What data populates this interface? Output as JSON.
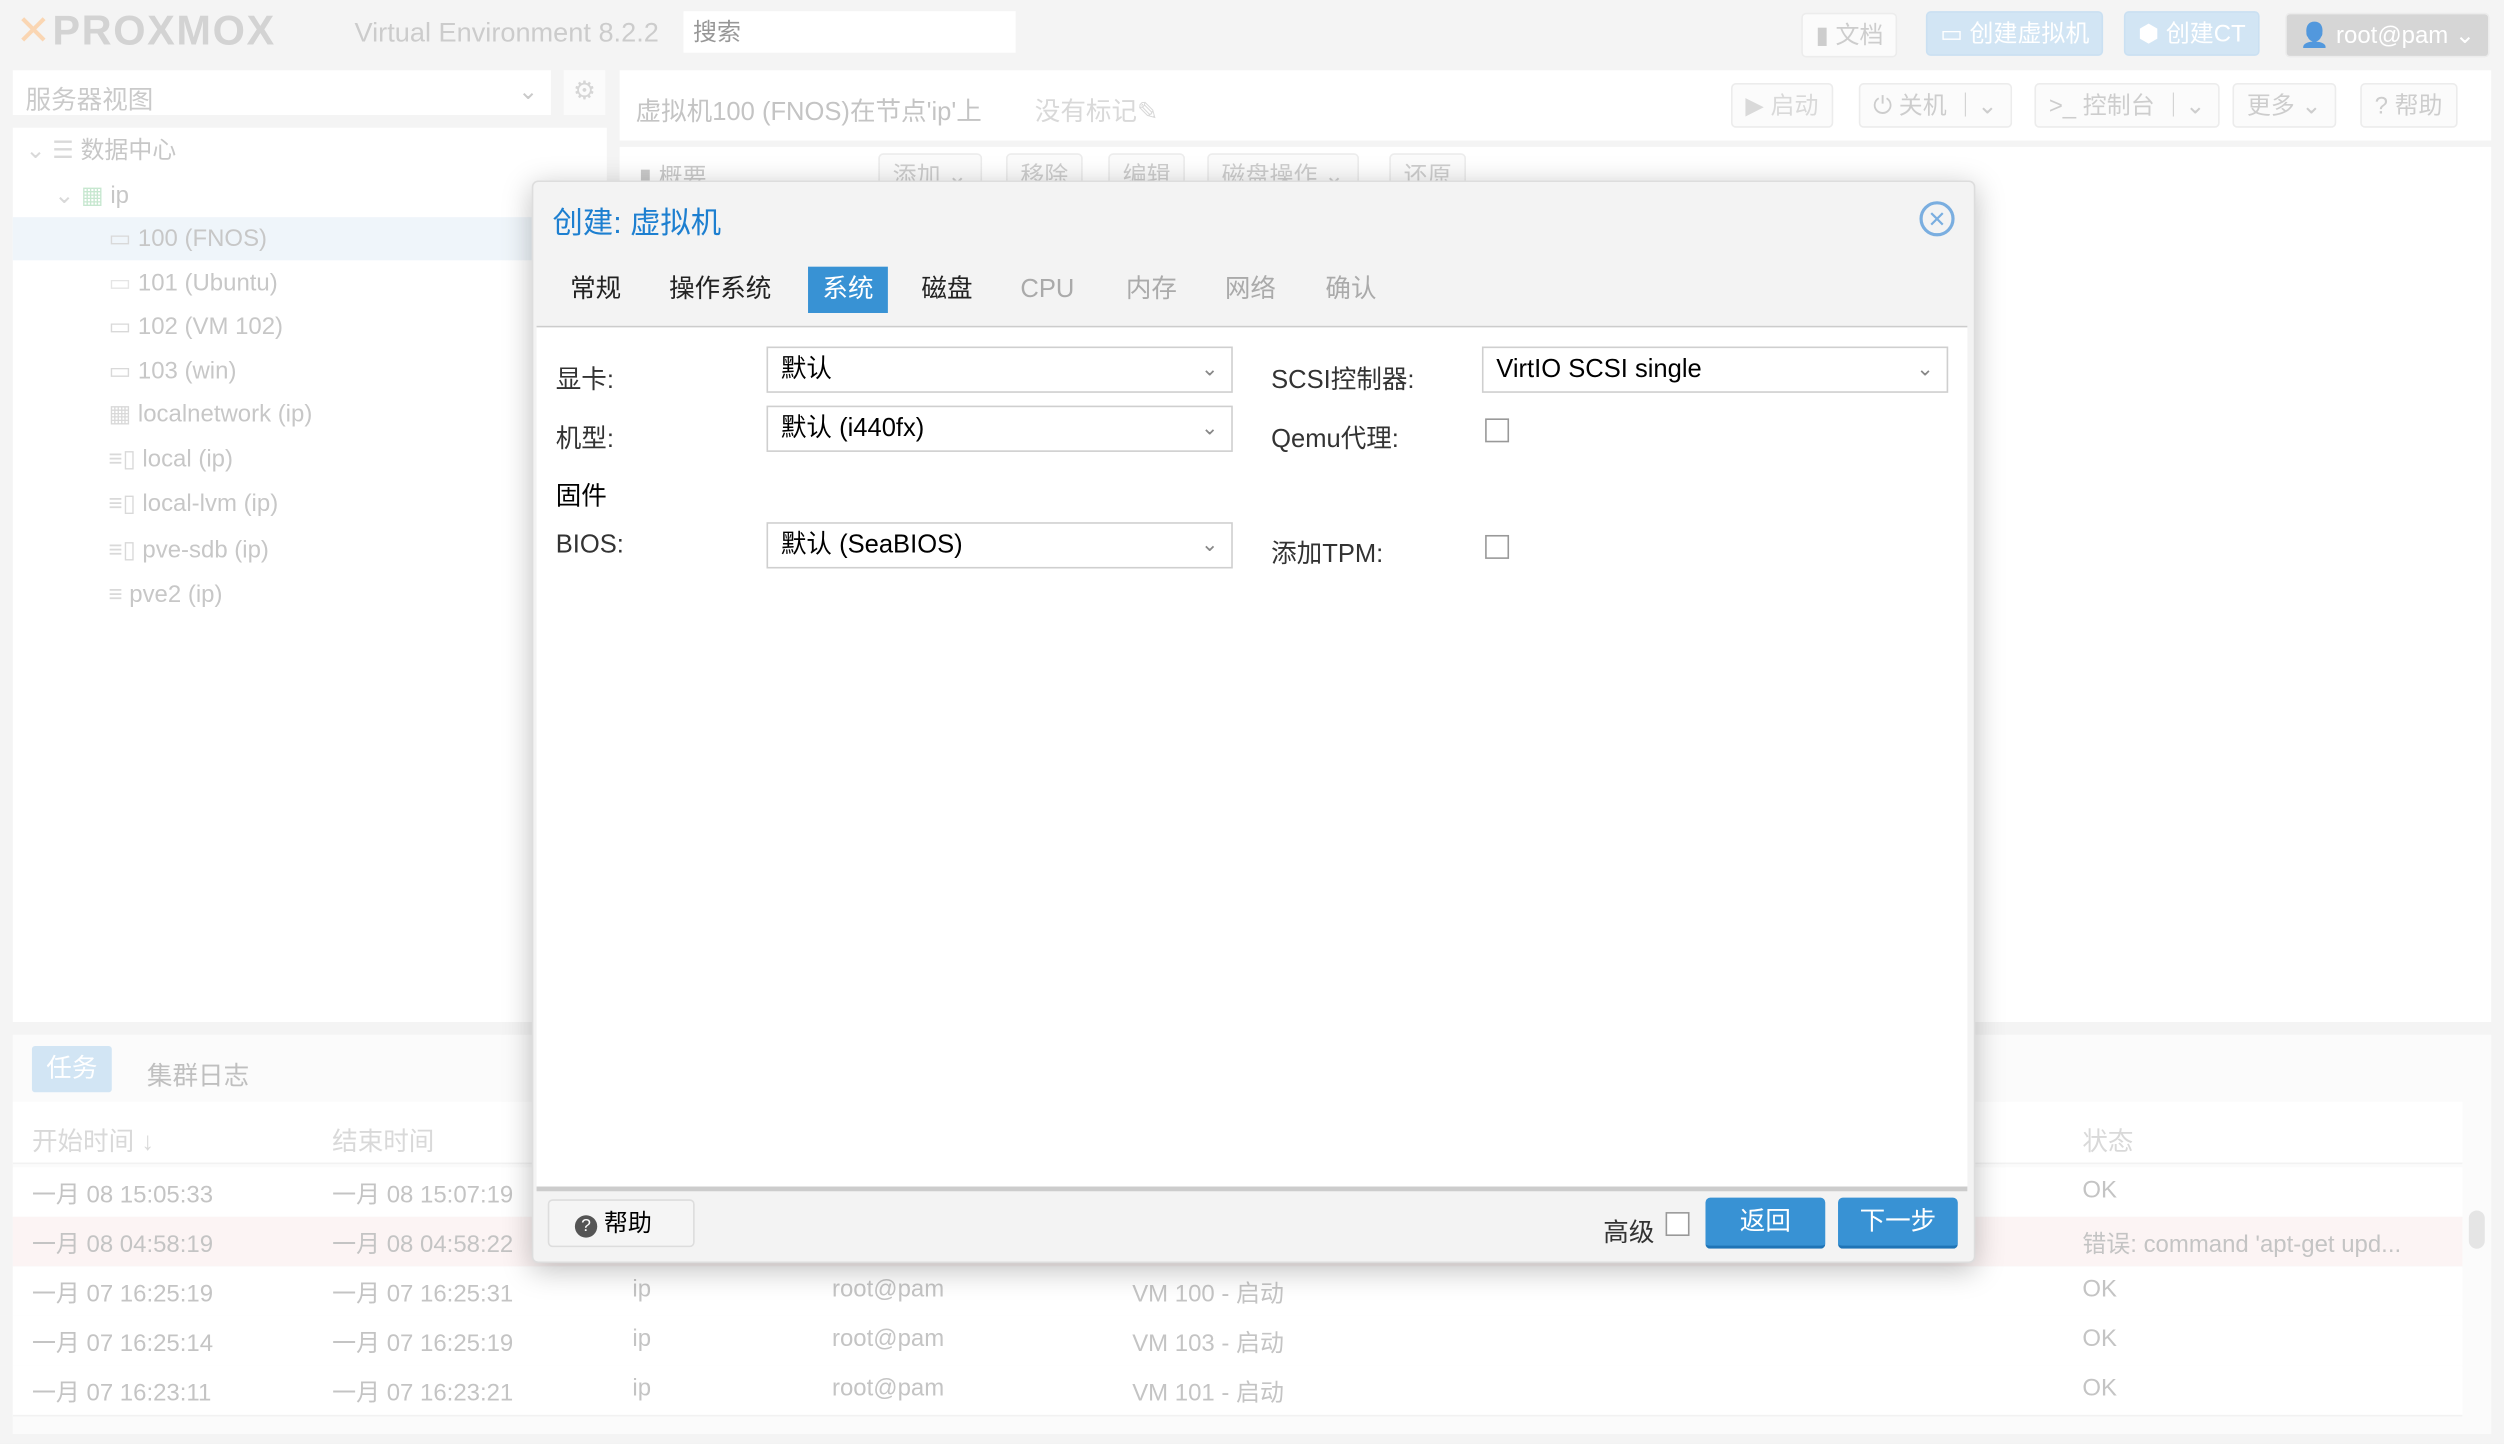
{
  "header": {
    "logo": "PROXMOX",
    "version": "Virtual Environment 8.2.2",
    "search_placeholder": "搜索",
    "docs": "文档",
    "create_vm": "创建虚拟机",
    "create_ct": "创建CT",
    "user": "root@pam"
  },
  "sidebar": {
    "view": "服务器视图",
    "items": [
      {
        "label": "数据中心",
        "icon": "datacenter-icon"
      },
      {
        "label": "ip",
        "icon": "node-online-icon"
      },
      {
        "label": "100 (FNOS)",
        "icon": "vm-running-icon"
      },
      {
        "label": "101 (Ubuntu)",
        "icon": "vm-stopped-icon"
      },
      {
        "label": "102 (VM 102)",
        "icon": "vm-running-icon"
      },
      {
        "label": "103 (win)",
        "icon": "vm-running-icon"
      },
      {
        "label": "localnetwork (ip)",
        "icon": "network-icon"
      },
      {
        "label": "local (ip)",
        "icon": "storage-icon"
      },
      {
        "label": "local-lvm (ip)",
        "icon": "storage-icon"
      },
      {
        "label": "pve-sdb (ip)",
        "icon": "storage-icon"
      },
      {
        "label": "pve2 (ip)",
        "icon": "storage-unknown-icon"
      }
    ]
  },
  "content": {
    "title": "虚拟机100 (FNOS)在节点'ip'上",
    "tags": "没有标记",
    "start": "启动",
    "shutdown": "关机",
    "console": "控制台",
    "more": "更多",
    "help": "帮助",
    "nav_summary": "概要",
    "sub_buttons": [
      "添加",
      "移除",
      "编辑",
      "磁盘操作",
      "还原"
    ]
  },
  "tasks": {
    "tabs": [
      "任务",
      "集群日志"
    ],
    "columns": {
      "start": "开始时间",
      "end": "结束时间",
      "status": "状态"
    },
    "rows": [
      {
        "start": "一月 08 15:05:33",
        "end": "一月 08 15:07:19",
        "node": "",
        "user": "",
        "desc": "",
        "status": "OK",
        "error": false
      },
      {
        "start": "一月 08 04:58:19",
        "end": "一月 08 04:58:22",
        "node": "",
        "user": "",
        "desc": "",
        "status": "错误: command 'apt-get upd...",
        "error": true
      },
      {
        "start": "一月 07 16:25:19",
        "end": "一月 07 16:25:31",
        "node": "ip",
        "user": "root@pam",
        "desc": "VM 100 - 启动",
        "status": "OK",
        "error": false
      },
      {
        "start": "一月 07 16:25:14",
        "end": "一月 07 16:25:19",
        "node": "ip",
        "user": "root@pam",
        "desc": "VM 103 - 启动",
        "status": "OK",
        "error": false
      },
      {
        "start": "一月 07 16:23:11",
        "end": "一月 07 16:23:21",
        "node": "ip",
        "user": "root@pam",
        "desc": "VM 101 - 启动",
        "status": "OK",
        "error": false
      }
    ]
  },
  "dialog": {
    "title": "创建: 虚拟机",
    "tabs": [
      "常规",
      "操作系统",
      "系统",
      "磁盘",
      "CPU",
      "内存",
      "网络",
      "确认"
    ],
    "active_tab": 2,
    "fields": {
      "graphics_label": "显卡:",
      "graphics_value": "默认",
      "machine_label": "机型:",
      "machine_value": "默认 (i440fx)",
      "firmware_heading": "固件",
      "bios_label": "BIOS:",
      "bios_value": "默认 (SeaBIOS)",
      "scsi_label": "SCSI控制器:",
      "scsi_value": "VirtIO SCSI single",
      "qemu_agent_label": "Qemu代理:",
      "qemu_agent_checked": false,
      "tpm_label": "添加TPM:",
      "tpm_checked": false
    },
    "help": "帮助",
    "advanced": "高级",
    "advanced_checked": false,
    "back": "返回",
    "next": "下一步"
  },
  "colors": {
    "accent": "#3892d4",
    "active_tab": "#3892d4",
    "title": "#1d7fd0"
  }
}
